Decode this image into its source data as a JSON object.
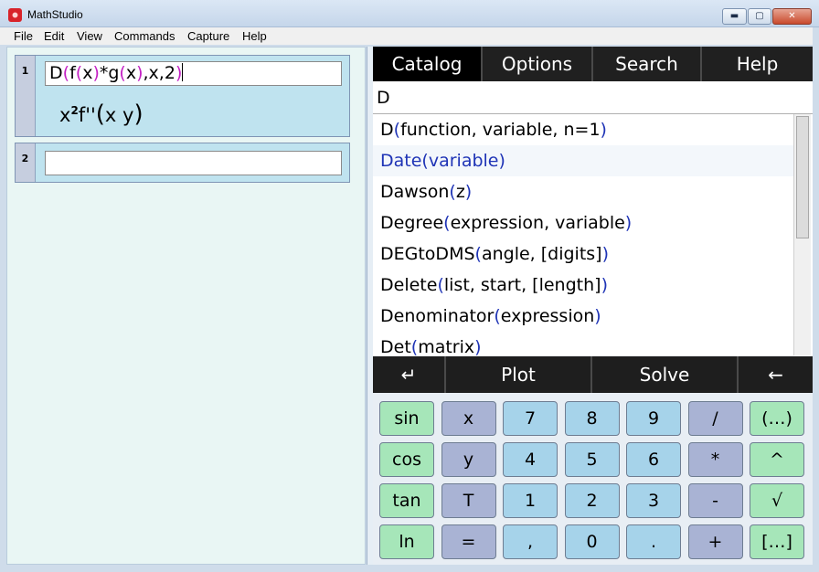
{
  "window": {
    "title": "MathStudio",
    "min_glyph": "▬",
    "max_glyph": "▢",
    "close_glyph": "✕"
  },
  "menu": [
    "File",
    "Edit",
    "View",
    "Commands",
    "Capture",
    "Help"
  ],
  "cells": [
    {
      "number": "1",
      "input_parts": [
        {
          "t": "D",
          "c": "k"
        },
        {
          "t": "(",
          "c": "m"
        },
        {
          "t": "f",
          "c": "k"
        },
        {
          "t": "(",
          "c": "m"
        },
        {
          "t": "x",
          "c": "k"
        },
        {
          "t": ")",
          "c": "m"
        },
        {
          "t": "*g",
          "c": "k"
        },
        {
          "t": "(",
          "c": "m"
        },
        {
          "t": "x",
          "c": "k"
        },
        {
          "t": ")",
          "c": "m"
        },
        {
          "t": ",x,2",
          "c": "k"
        },
        {
          "t": ")",
          "c": "m"
        }
      ],
      "result": {
        "base": "x",
        "exp": "2",
        "rest": "f''",
        "paren_open": "(",
        "args": "x y",
        "paren_close": ")"
      }
    },
    {
      "number": "2",
      "input_parts": []
    }
  ],
  "tabs": [
    "Catalog",
    "Options",
    "Search",
    "Help"
  ],
  "active_tab": "Catalog",
  "search_text": "D",
  "catalog": [
    {
      "name": "D",
      "args": "function, variable, n=1"
    },
    {
      "name": "Date",
      "args": "variable"
    },
    {
      "name": "Dawson",
      "args": "z"
    },
    {
      "name": "Degree",
      "args": "expression, variable"
    },
    {
      "name": "DEGtoDMS",
      "args": "angle, [digits]"
    },
    {
      "name": "Delete",
      "args": "list, start, [length]"
    },
    {
      "name": "Denominator",
      "args": "expression"
    },
    {
      "name": "Det",
      "args": "matrix"
    }
  ],
  "selected_catalog_index": 1,
  "actions": [
    "↵",
    "Plot",
    "Solve",
    "←"
  ],
  "keypad": [
    [
      "sin",
      "x",
      "7",
      "8",
      "9",
      "/",
      "(…)"
    ],
    [
      "cos",
      "y",
      "4",
      "5",
      "6",
      "*",
      "^"
    ],
    [
      "tan",
      "T",
      "1",
      "2",
      "3",
      "-",
      "√"
    ],
    [
      "ln",
      "=",
      ",",
      "0",
      ".",
      "+",
      "[…]"
    ]
  ],
  "colors": {
    "paren": "#c420c4",
    "catalog_paren": "#1f34b6",
    "accent_dark": "#000000"
  }
}
